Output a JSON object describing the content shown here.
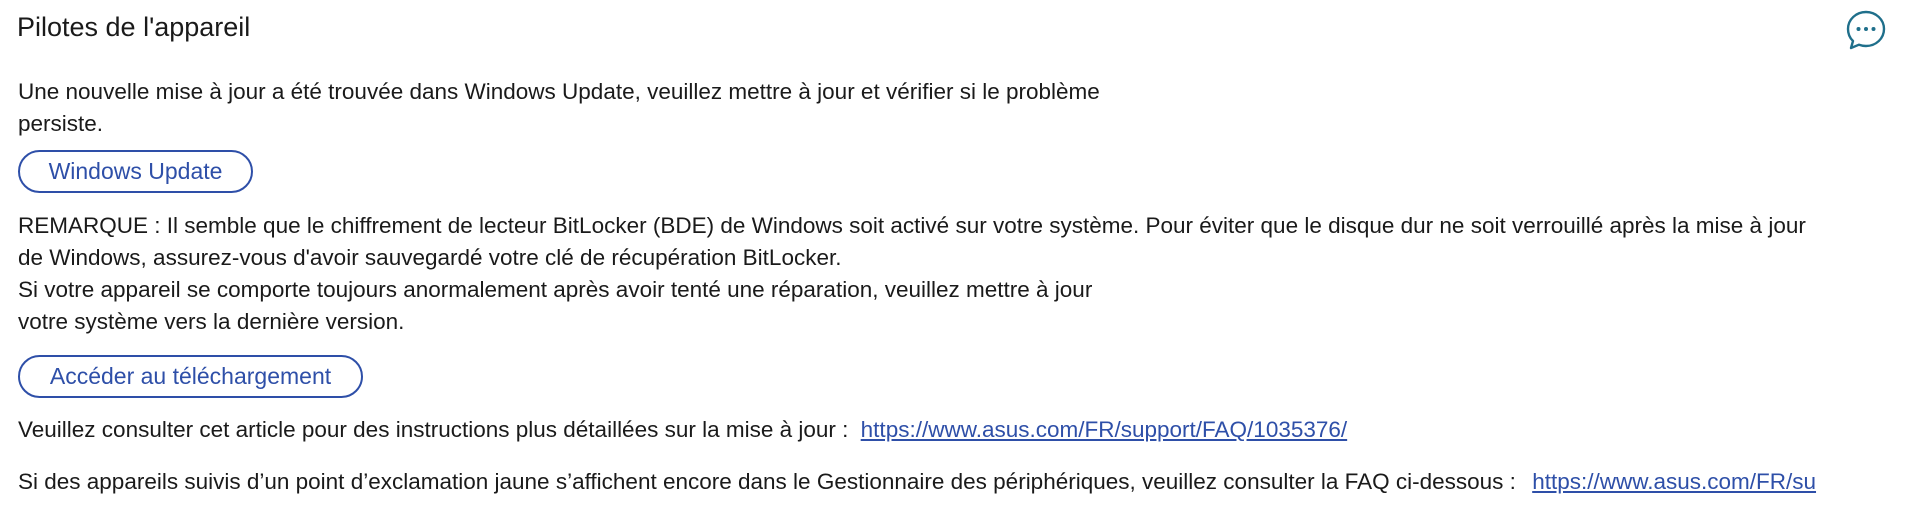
{
  "header": {
    "title": "Pilotes de l'appareil",
    "feedback_icon": "chat-bubble-ellipsis-icon"
  },
  "update_notice": {
    "line1": "Une nouvelle mise à jour a été trouvée dans Windows Update, veuillez mettre à jour et vérifier si le problème",
    "line2": "persiste.",
    "button_label": "Windows Update"
  },
  "bitlocker_note": {
    "line1": "REMARQUE : Il semble que le chiffrement de lecteur BitLocker (BDE) de Windows soit activé sur votre système. Pour éviter que le disque dur ne soit verrouillé après la mise à jour",
    "line2": "de Windows, assurez-vous d'avoir sauvegardé votre clé de récupération BitLocker."
  },
  "system_update": {
    "line1": "Si votre appareil se comporte toujours anormalement après avoir tenté une réparation, veuillez mettre à jour",
    "line2": "votre système vers la dernière version.",
    "button_label": "Accéder au téléchargement"
  },
  "article": {
    "text": "Veuillez consulter cet article pour des instructions plus détaillées sur la mise à jour :",
    "link": "https://www.asus.com/FR/support/FAQ/1035376/"
  },
  "faq": {
    "text": "Si des appareils suivis d’un point d’exclamation jaune s’affichent encore dans le Gestionnaire des périphériques, veuillez consulter la FAQ ci-dessous :",
    "link": "https://www.asus.com/FR/su"
  },
  "colors": {
    "accent": "#2e4fa8",
    "text": "#1a1a1a",
    "icon": "#1f6f8b"
  }
}
